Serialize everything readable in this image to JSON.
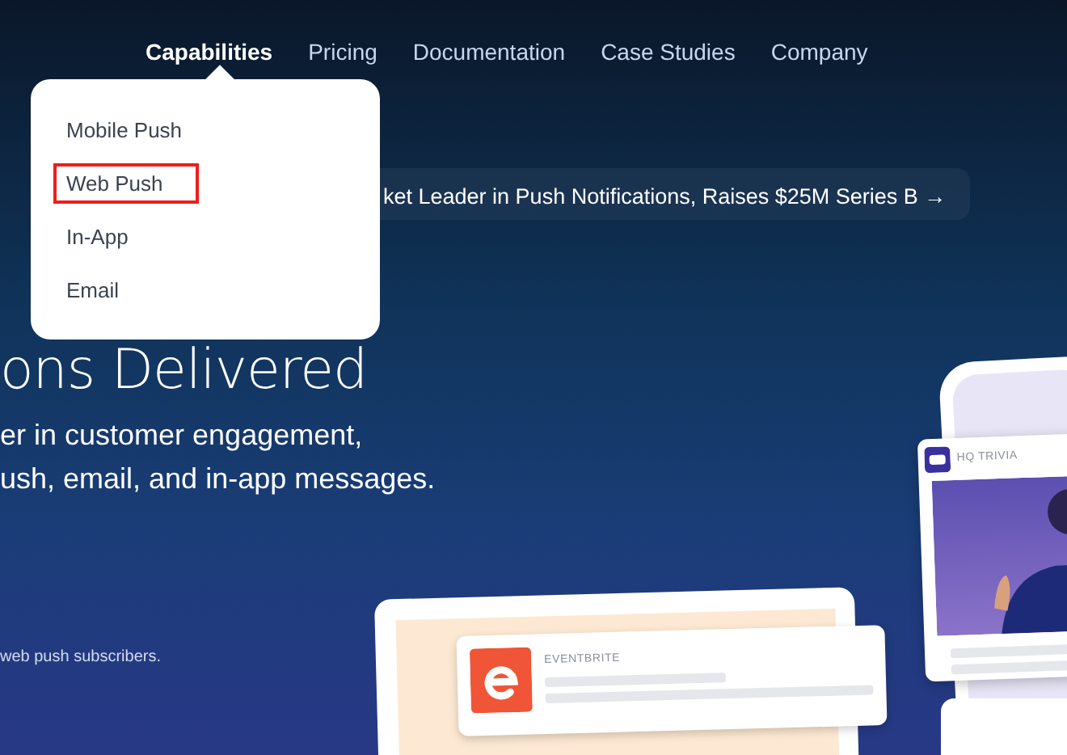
{
  "nav": {
    "items": [
      {
        "label": "Capabilities",
        "selected": true
      },
      {
        "label": "Pricing",
        "selected": false
      },
      {
        "label": "Documentation",
        "selected": false
      },
      {
        "label": "Case Studies",
        "selected": false
      },
      {
        "label": "Company",
        "selected": false
      }
    ]
  },
  "dropdown": {
    "items": [
      {
        "label": "Mobile Push",
        "highlighted": false
      },
      {
        "label": "Web Push",
        "highlighted": true
      },
      {
        "label": "In-App",
        "highlighted": false
      },
      {
        "label": "Email",
        "highlighted": false
      }
    ]
  },
  "announcement": "ket Leader in Push Notifications, Raises $25M Series B →",
  "hero": {
    "headline": "ons Delivered",
    "subtitle_lines": [
      "er in customer engagement,",
      "ush, email, and in-app messages."
    ],
    "footnote": "web push subscribers."
  },
  "mockups": {
    "web_notification": {
      "app": "EVENTBRITE"
    },
    "phone_notification": {
      "app": "HQ TRIVIA"
    }
  }
}
